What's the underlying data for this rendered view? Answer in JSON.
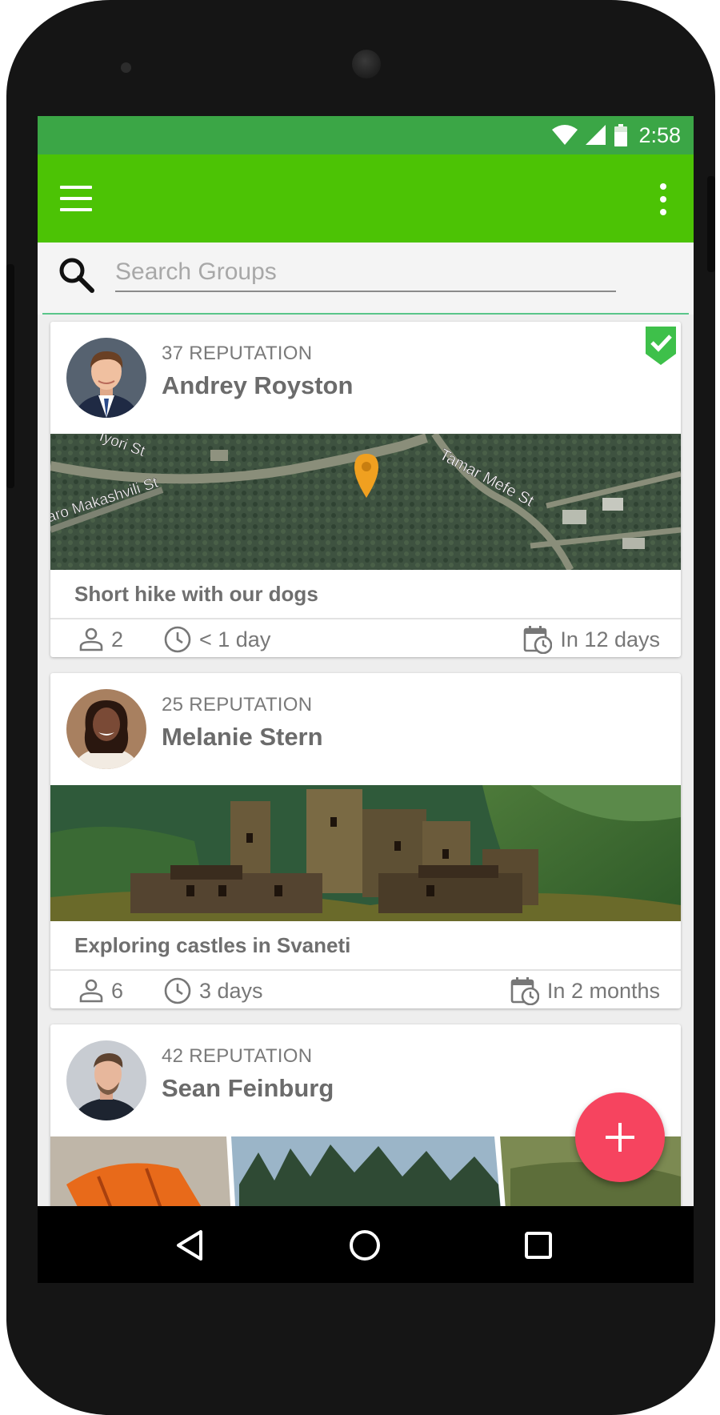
{
  "status_bar": {
    "time": "2:58",
    "wifi_icon": "wifi-icon",
    "signal_icon": "signal-icon",
    "battery_icon": "battery-icon"
  },
  "app_bar": {
    "menu_icon": "hamburger-menu-icon",
    "overflow_icon": "more-vert-icon",
    "color": "#4cc305"
  },
  "search": {
    "placeholder": "Search Groups",
    "value": ""
  },
  "groups": [
    {
      "reputation": "37 REPUTATION",
      "name": "Andrey Royston",
      "joined": true,
      "image": "map",
      "title": "Short hike with our dogs",
      "members": "2",
      "duration": "< 1 day",
      "starts": "In 12 days",
      "map_labels": [
        "Tamar Mefe St",
        "aro Makashvili St",
        "Iyori St"
      ]
    },
    {
      "reputation": "25 REPUTATION",
      "name": "Melanie Stern",
      "joined": false,
      "image": "castles",
      "title": "Exploring castles in Svaneti",
      "members": "6",
      "duration": "3 days",
      "starts": "In 2 months"
    },
    {
      "reputation": "42 REPUTATION",
      "name": "Sean Feinburg",
      "joined": false,
      "image": "collage"
    }
  ],
  "fab": {
    "icon": "plus-icon",
    "color": "#f6445f"
  },
  "nav_bar": {
    "back_icon": "back-icon",
    "home_icon": "home-icon",
    "recents_icon": "recents-icon"
  }
}
